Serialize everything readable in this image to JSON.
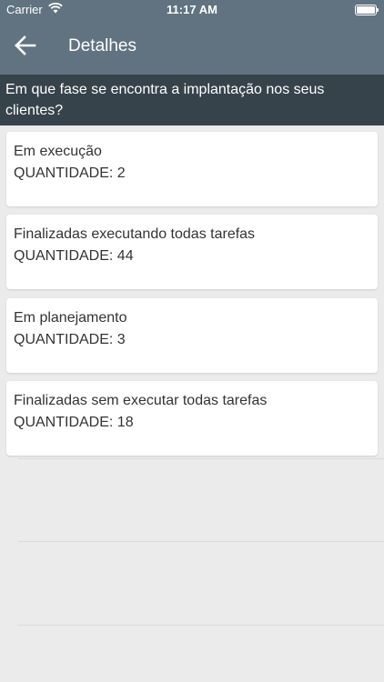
{
  "status_bar": {
    "carrier": "Carrier",
    "time": "11:17 AM"
  },
  "nav": {
    "title": "Detalhes",
    "back_icon": "arrow-left-icon"
  },
  "question": "Em que fase se encontra a implantação nos seus clientes?",
  "items": [
    {
      "label": "Em execução",
      "quantity": "QUANTIDADE: 2"
    },
    {
      "label": "Finalizadas executando todas tarefas",
      "quantity": "QUANTIDADE: 44"
    },
    {
      "label": "Em planejamento",
      "quantity": "QUANTIDADE: 3"
    },
    {
      "label": "Finalizadas sem executar todas tarefas",
      "quantity": "QUANTIDADE: 18"
    }
  ],
  "colors": {
    "header": "#617380",
    "question_bar": "#37434b",
    "background": "#ebebeb",
    "card": "#ffffff"
  }
}
